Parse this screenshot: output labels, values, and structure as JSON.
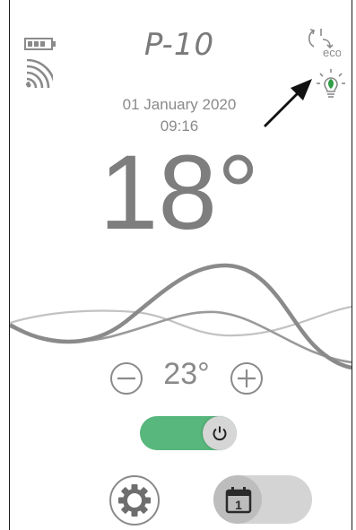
{
  "header": {
    "device_title": "P-10",
    "eco_label": "eco"
  },
  "datetime": {
    "date": "01 January 2020",
    "time": "09:16"
  },
  "temperature": {
    "current": "18°",
    "setpoint": "23°"
  },
  "status": {
    "power_on": true,
    "schedule_on": false,
    "schedule_day": "1"
  },
  "colors": {
    "text_gray": "#7a7a7a",
    "toggle_on_green": "#57b77c",
    "toggle_off_gray": "#d4d4d4",
    "eco_leaf_green": "#2f9e44",
    "arrow_black": "#111111"
  },
  "icons": {
    "battery": "battery-icon",
    "signal": "wifi-signal-icon",
    "eco_mode": "eco-mode-icon",
    "eco_bulb": "eco-bulb-icon",
    "pointer_arrow": "pointer-arrow-icon",
    "minus": "minus-circle-icon",
    "plus": "plus-circle-icon",
    "power": "power-icon",
    "settings": "gear-icon",
    "schedule": "calendar-icon"
  }
}
